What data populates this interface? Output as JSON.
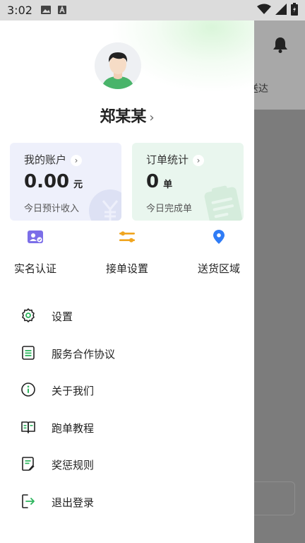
{
  "status_bar": {
    "time": "3:02"
  },
  "background_app": {
    "partial_text": "送达"
  },
  "profile": {
    "name": "郑某某",
    "chevron": "›"
  },
  "cards": {
    "account": {
      "title": "我的账户",
      "value": "0.00",
      "unit": "元",
      "subtitle": "今日预计收入"
    },
    "orders": {
      "title": "订单统计",
      "value": "0",
      "unit": "单",
      "subtitle": "今日完成单"
    }
  },
  "quick_actions": [
    {
      "label": "实名认证",
      "icon": "id-card-icon"
    },
    {
      "label": "接单设置",
      "icon": "sliders-icon"
    },
    {
      "label": "送货区域",
      "icon": "location-pin-icon"
    }
  ],
  "menu": [
    {
      "label": "设置",
      "icon": "gear-icon"
    },
    {
      "label": "服务合作协议",
      "icon": "document-icon"
    },
    {
      "label": "关于我们",
      "icon": "info-icon"
    },
    {
      "label": "跑单教程",
      "icon": "book-icon"
    },
    {
      "label": "奖惩规则",
      "icon": "rules-icon"
    },
    {
      "label": "退出登录",
      "icon": "logout-icon"
    }
  ],
  "colors": {
    "primary_green": "#2db55d",
    "account_card_bg": "#eef0fb",
    "orders_card_bg": "#e9f6ee",
    "id_icon": "#7b6ee8",
    "sliders_icon": "#f0a51f",
    "pin_icon": "#2f7cf6"
  }
}
